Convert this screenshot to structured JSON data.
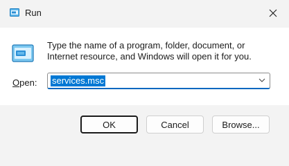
{
  "window": {
    "title": "Run",
    "close_icon": "close-icon"
  },
  "dialog": {
    "description": "Type the name of a program, folder, document, or Internet resource, and Windows will open it for you.",
    "open_label_prefix": "O",
    "open_label_rest": "pen:",
    "open_value": "services.msc",
    "run_icon": "run-icon"
  },
  "buttons": {
    "ok": "OK",
    "cancel": "Cancel",
    "browse": "Browse..."
  },
  "colors": {
    "selection": "#0078d4",
    "accent_underline": "#0067c0",
    "icon_blue": "#3a9ad9"
  }
}
